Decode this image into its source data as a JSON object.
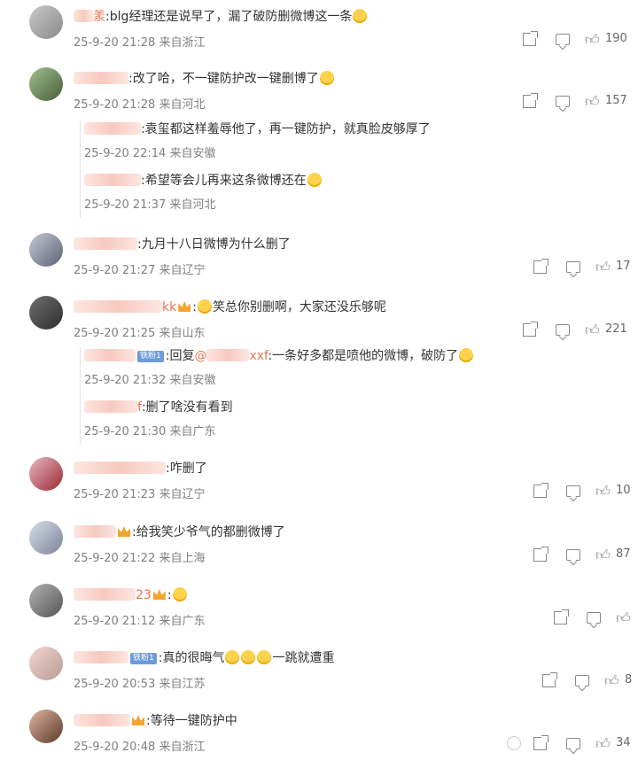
{
  "comments": [
    {
      "suffix": "羕",
      "text": ":blg经理还是说早了，漏了破防删微博这一条",
      "meta": "25-9-20 21:28 来自浙江",
      "likes": "190"
    },
    {
      "suffix": "",
      "text": ":改了哈，不一键防护改一键删博了",
      "meta": "25-9-20 21:28 来自河北",
      "likes": "157",
      "replies": [
        {
          "text": ":袁玺都这样羞辱他了，再一键防护，就真脸皮够厚了",
          "meta": "25-9-20 22:14 来自安徽"
        },
        {
          "text": ":希望等会儿再来这条微博还在",
          "meta": "25-9-20 21:37 来自河北"
        }
      ]
    },
    {
      "suffix": "",
      "text": ":九月十八日微博为什么删了",
      "meta": "25-9-20 21:27 来自辽宁",
      "likes": "17"
    },
    {
      "suffix": "kk",
      "text": "笑总你别删啊，大家还没乐够呢",
      "meta": "25-9-20 21:25 来自山东",
      "likes": "221",
      "replies": [
        {
          "badge": "铁粉1",
          "reply_prefix": ":回复",
          "mention_suffix": "xxf",
          "text": ":一条好多都是喷他的微博，破防了",
          "meta": "25-9-20 21:32 来自安徽"
        },
        {
          "suffix": "f",
          "text": ":删了啥没有看到",
          "meta": "25-9-20 21:30 来自广东"
        }
      ]
    },
    {
      "suffix": "",
      "text": ":咋删了",
      "meta": "25-9-20 21:23 来自辽宁",
      "likes": "10"
    },
    {
      "suffix": "",
      "text": ":给我笑少爷气的都删微博了",
      "meta": "25-9-20 21:22 来自上海",
      "likes": "87"
    },
    {
      "suffix": "23",
      "text": ":",
      "meta": "25-9-20 21:12 来自广东",
      "likes": ""
    },
    {
      "badge": "铁粉1",
      "suffix": "",
      "text": ":真的很晦气",
      "text_after": "一跳就遭重",
      "meta": "25-9-20 20:53 来自江苏",
      "likes": "8"
    },
    {
      "suffix": "",
      "text": ":等待一键防护中",
      "meta": "25-9-20 20:48 来自浙江",
      "likes": "34"
    }
  ],
  "icons": {
    "share": "share-icon",
    "comment": "comment-icon",
    "like": "thumbs-up-icon"
  },
  "colors": {
    "username": "#eb7350",
    "meta": "#808080",
    "badge": "#6d9bd8"
  }
}
